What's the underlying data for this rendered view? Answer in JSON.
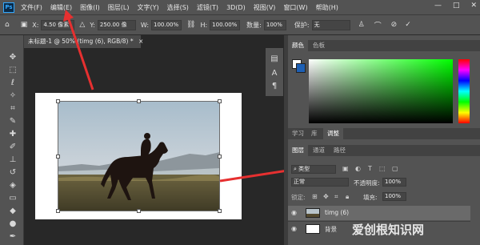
{
  "app": {
    "logo": "Ps"
  },
  "menu": [
    "文件(F)",
    "编辑(E)",
    "图像(I)",
    "图层(L)",
    "文字(Y)",
    "选择(S)",
    "滤镜(T)",
    "3D(D)",
    "视图(V)",
    "窗口(W)",
    "帮助(H)"
  ],
  "window_controls": {
    "minimize": "—",
    "restore": "□",
    "close": "✕"
  },
  "options": {
    "x_label": "X:",
    "x_value": "4.50 像素",
    "y_label": "Y:",
    "y_value": "250.00 像",
    "w_label": "W:",
    "w_value": "100.00%",
    "h_label": "H:",
    "h_value": "100.00%",
    "angle_label": "△",
    "angle_value": "0.00",
    "degree": "度",
    "interp_label": "数量:",
    "interp_value": "100%",
    "warp_label": "保护:",
    "warp_value": "无"
  },
  "document": {
    "tab_title": "未标题-1 @ 50% (timg (6), RGB/8) *",
    "close": "×"
  },
  "color_panel": {
    "tabs": [
      "颜色",
      "色板"
    ],
    "fg_color": "#ffffff",
    "bg_color": "#1d5fb4",
    "hue_colors": [
      "#ff0000",
      "#ff00ff",
      "#0000ff",
      "#00ffff",
      "#00ff00",
      "#ffff00",
      "#ff0000"
    ],
    "field_color": "#00ff00"
  },
  "learn_tabs": [
    "学习",
    "库",
    "调整"
  ],
  "layers_panel": {
    "tabs": [
      "图层",
      "通道",
      "路径"
    ],
    "search_placeholder": "类型",
    "blend_mode": "正常",
    "opacity_label": "不透明度:",
    "opacity_value": "100%",
    "lock_label": "锁定:",
    "fill_label": "填充:",
    "fill_value": "100%",
    "layers": [
      {
        "name": "timg (6)",
        "selected": true
      },
      {
        "name": "背景",
        "selected": false
      }
    ]
  },
  "watermark": "爱创根知识网"
}
